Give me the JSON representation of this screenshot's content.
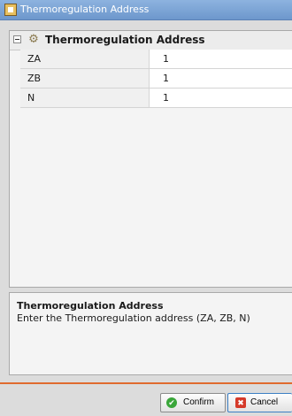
{
  "window": {
    "title": "Thermoregulation Address",
    "icon": "app-icon"
  },
  "section": {
    "title": "Thermoregulation Address",
    "collapse_icon": "collapse-icon",
    "icon": "gear-icon"
  },
  "properties": [
    {
      "name": "ZA",
      "value": "1"
    },
    {
      "name": "ZB",
      "value": "1"
    },
    {
      "name": "N",
      "value": "1"
    }
  ],
  "description": {
    "title": "Thermoregulation Address",
    "text": "Enter the Thermoregulation address (ZA, ZB, N)"
  },
  "buttons": {
    "confirm": {
      "label": "Confirm",
      "icon": "check-icon"
    },
    "cancel": {
      "label": "Cancel",
      "icon": "close-icon"
    }
  },
  "colors": {
    "accent_line": "#e06b2e",
    "titlebar": "#7aa3d6"
  }
}
